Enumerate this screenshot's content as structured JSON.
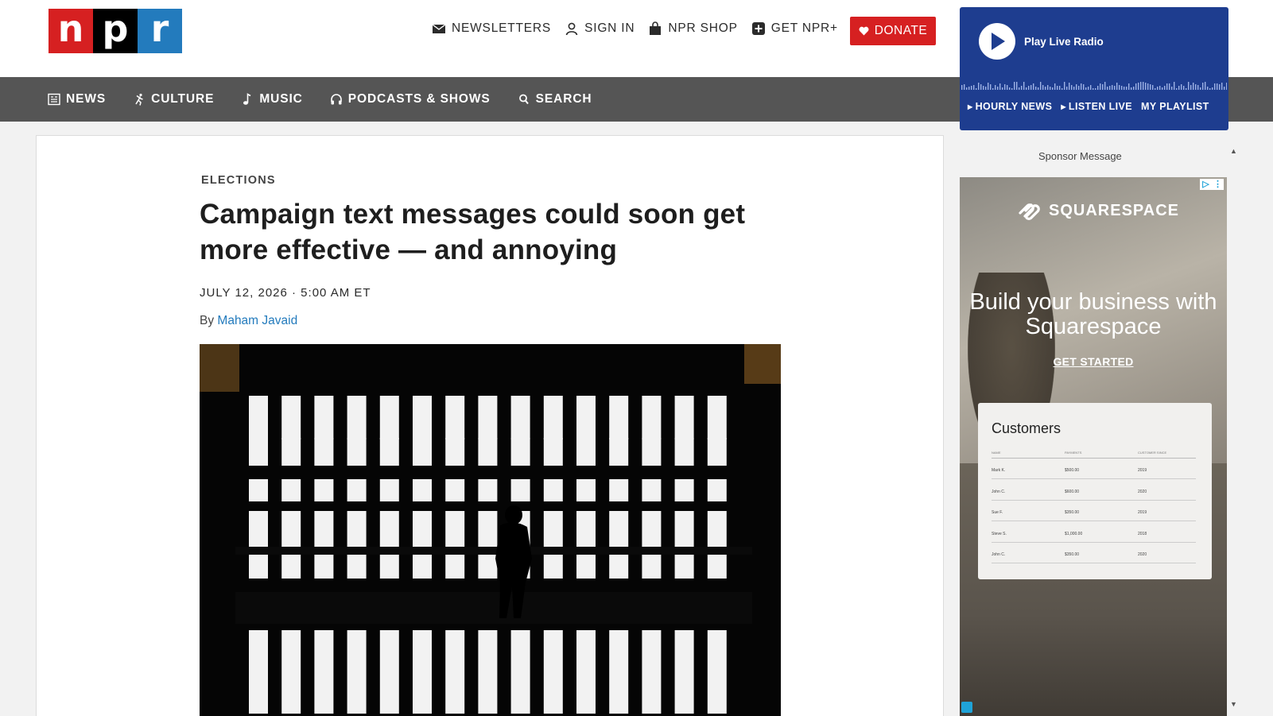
{
  "logo": {
    "letters": [
      "n",
      "p",
      "r"
    ]
  },
  "header": {
    "newsletters": "NEWSLETTERS",
    "sign_in": "SIGN IN",
    "shop": "NPR SHOP",
    "plus": "GET NPR+",
    "donate": "DONATE"
  },
  "nav": [
    {
      "label": "NEWS",
      "icon": "news-icon"
    },
    {
      "label": "CULTURE",
      "icon": "culture-icon"
    },
    {
      "label": "MUSIC",
      "icon": "music-icon"
    },
    {
      "label": "PODCASTS & SHOWS",
      "icon": "headphones-icon"
    },
    {
      "label": "SEARCH",
      "icon": "search-icon"
    }
  ],
  "radio": {
    "play_label": "Play Live Radio",
    "links": [
      "HOURLY NEWS",
      "LISTEN LIVE",
      "MY PLAYLIST"
    ]
  },
  "article": {
    "section": "ELECTIONS",
    "headline": "Campaign text messages could soon get more effective — and annoying",
    "dateline": "JULY 12, 2026 · 5:00 AM ET",
    "by_prefix": "By",
    "author": "Maham Javaid"
  },
  "sponsor": {
    "label": "Sponsor Message",
    "brand": "SQUARESPACE",
    "headline": "Build your business with Squarespace",
    "cta": "GET STARTED",
    "table": {
      "title": "Customers",
      "columns": [
        "NAME",
        "PAYMENTS",
        "CUSTOMER SINCE"
      ],
      "rows": [
        [
          "Mark K.",
          "$500.00",
          "2019"
        ],
        [
          "John C.",
          "$600.00",
          "2020"
        ],
        [
          "Sue F.",
          "$350.00",
          "2019"
        ],
        [
          "Steve S.",
          "$1,000.00",
          "2018"
        ],
        [
          "John C.",
          "$350.00",
          "2020"
        ]
      ]
    }
  },
  "colors": {
    "npr_red": "#d62021",
    "npr_blue": "#237bbd",
    "radio_bg": "#1e3d8f",
    "nav_bg": "#555555",
    "link": "#237bbd"
  }
}
